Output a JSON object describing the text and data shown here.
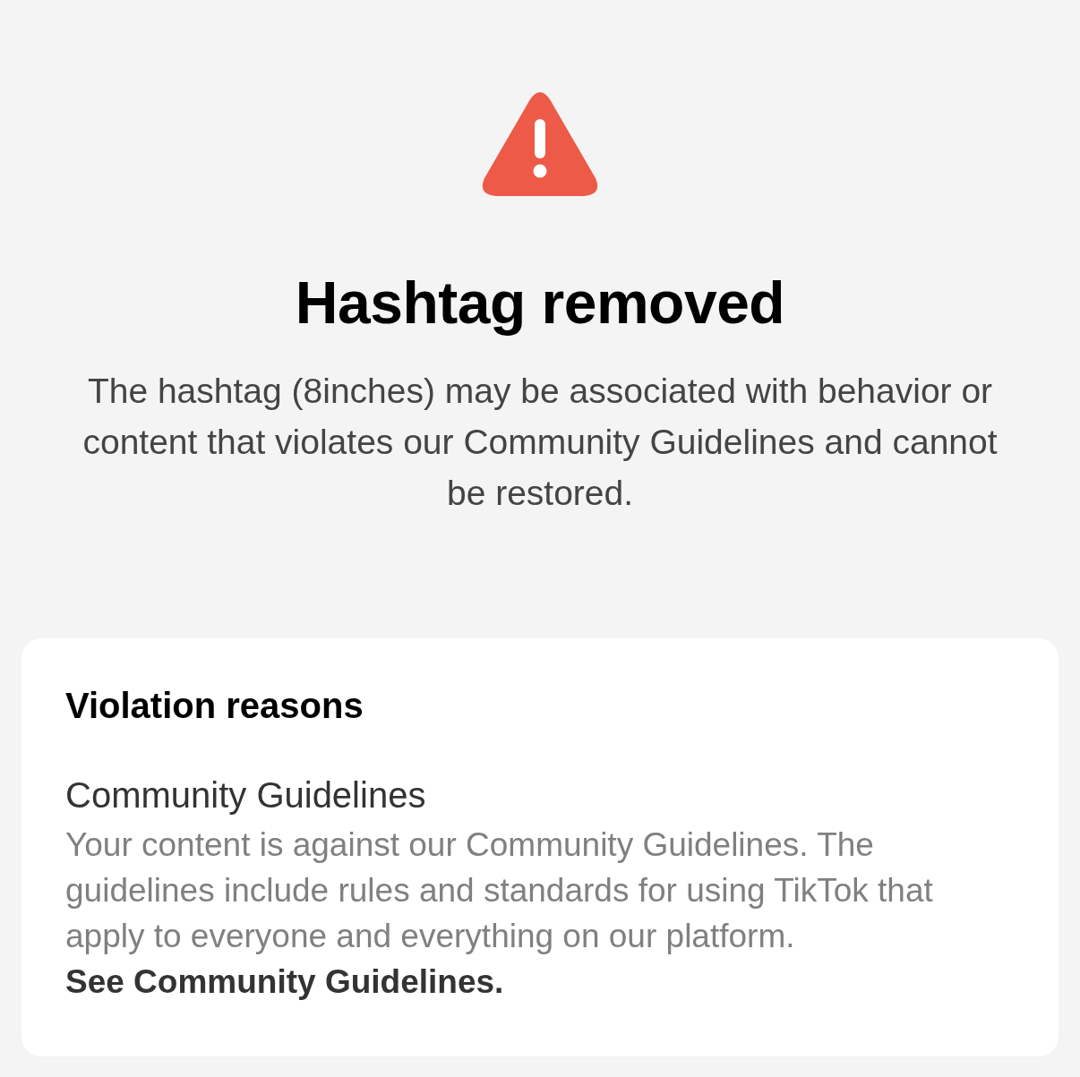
{
  "header": {
    "title": "Hashtag removed",
    "message": "The hashtag (8inches) may be associated with behavior or content that violates our Community Guidelines and cannot be restored."
  },
  "card": {
    "title": "Violation reasons",
    "reasons": [
      {
        "title": "Community Guidelines",
        "description": "Your content is against our Community Guidelines. The guidelines include rules and standards for using TikTok that apply to everyone and everything on our platform.",
        "link": "See Community Guidelines."
      }
    ]
  }
}
